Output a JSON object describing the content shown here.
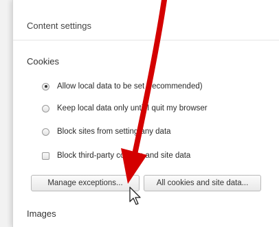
{
  "panel": {
    "title": "Content settings",
    "cookies": {
      "heading": "Cookies",
      "options": [
        {
          "label": "Allow local data to be set (recommended)",
          "selected": true
        },
        {
          "label": "Keep local data only until I quit my browser",
          "selected": false
        },
        {
          "label": "Block sites from setting any data",
          "selected": false
        }
      ],
      "block_third_party_label": "Block third-party cookies and site data",
      "block_third_party_checked": false,
      "manage_exceptions_label": "Manage exceptions...",
      "all_cookies_label": "All cookies and site data..."
    },
    "images": {
      "heading": "Images"
    }
  },
  "annotation": {
    "arrow_color": "#d40000",
    "icon": "red-arrow-icon"
  },
  "cursor_icon": "mouse-pointer-icon"
}
